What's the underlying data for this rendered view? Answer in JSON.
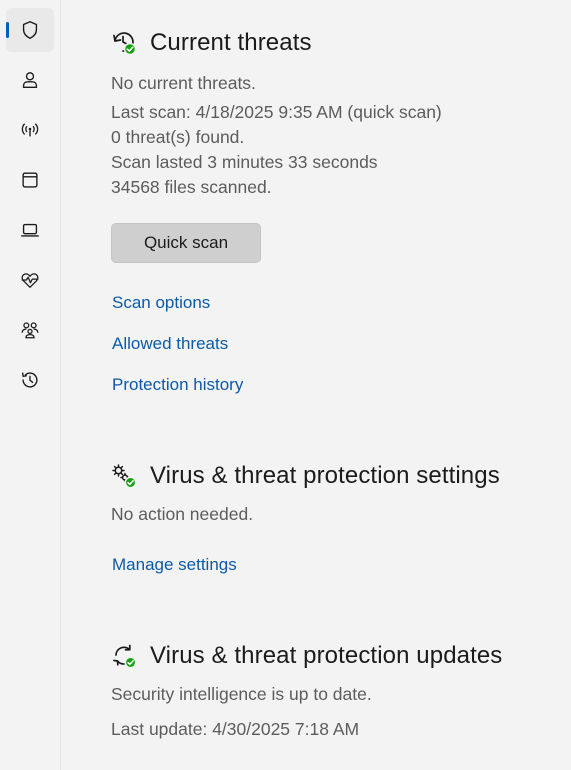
{
  "sidebar": {
    "items": [
      {
        "name": "shield-icon",
        "active": true
      },
      {
        "name": "person-icon",
        "active": false
      },
      {
        "name": "wireless-icon",
        "active": false
      },
      {
        "name": "app-window-icon",
        "active": false
      },
      {
        "name": "laptop-icon",
        "active": false
      },
      {
        "name": "heart-pulse-icon",
        "active": false
      },
      {
        "name": "family-icon",
        "active": false
      },
      {
        "name": "history-icon",
        "active": false
      }
    ]
  },
  "current_threats": {
    "title": "Current threats",
    "status": "No current threats.",
    "last_scan": "Last scan: 4/18/2025 9:35 AM (quick scan)",
    "threats_found": "0 threat(s) found.",
    "scan_duration": "Scan lasted 3 minutes 33 seconds",
    "files_scanned": "34568 files scanned.",
    "quick_scan_label": "Quick scan",
    "links": {
      "scan_options": "Scan options",
      "allowed_threats": "Allowed threats",
      "protection_history": "Protection history"
    }
  },
  "protection_settings": {
    "title": "Virus & threat protection settings",
    "status": "No action needed.",
    "manage_link": "Manage settings"
  },
  "protection_updates": {
    "title": "Virus & threat protection updates",
    "status": "Security intelligence is up to date.",
    "last_update": "Last update: 4/30/2025 7:18 AM"
  },
  "colors": {
    "accent": "#005fb8",
    "link": "#0b5aa8",
    "success_badge": "#13a10e",
    "background": "#f3f3f3"
  }
}
